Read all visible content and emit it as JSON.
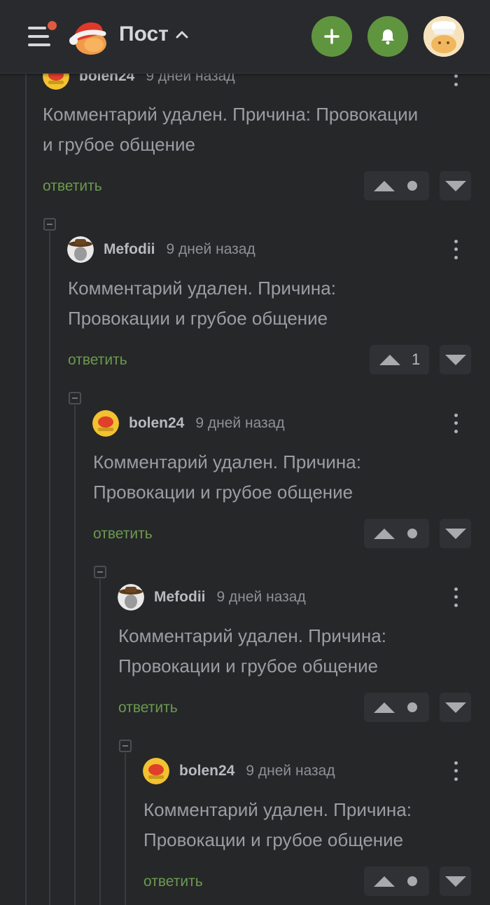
{
  "header": {
    "title": "Пост",
    "menu_icon": "hamburger-menu-icon",
    "logo_icon": "santa-hat-logo",
    "add_icon": "plus-icon",
    "notifications_icon": "bell-icon",
    "accent_color": "#609540",
    "badge_color": "#e05a3d"
  },
  "comments": [
    {
      "author": "bolen24",
      "time": "9 дней назад",
      "text_line1": "Комментарий удален. Причина: Провокации",
      "text_line2": "и грубое общение",
      "reply_label": "ответить",
      "rating": ""
    },
    {
      "author": "Mefodii",
      "time": "9 дней назад",
      "text_line1": "Комментарий удален. Причина:",
      "text_line2": "Провокации и грубое общение",
      "reply_label": "ответить",
      "rating": "1"
    },
    {
      "author": "bolen24",
      "time": "9 дней назад",
      "text_line1": "Комментарий удален. Причина:",
      "text_line2": "Провокации и грубое общение",
      "reply_label": "ответить",
      "rating": ""
    },
    {
      "author": "Mefodii",
      "time": "9 дней назад",
      "text_line1": "Комментарий удален. Причина:",
      "text_line2": "Провокации и грубое общение",
      "reply_label": "ответить",
      "rating": ""
    },
    {
      "author": "bolen24",
      "time": "9 дней назад",
      "text_line1": "Комментарий удален. Причина:",
      "text_line2": "Провокации и грубое общение",
      "reply_label": "ответить",
      "rating": ""
    }
  ]
}
